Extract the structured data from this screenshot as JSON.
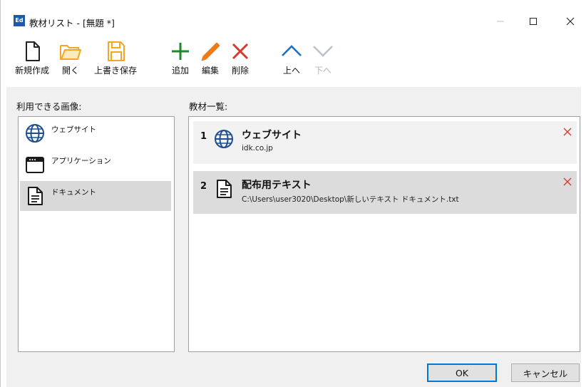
{
  "window": {
    "app_icon_text": "Ed",
    "title": "教材リスト - [無題 *]"
  },
  "toolbar": {
    "new_label": "新規作成",
    "open_label": "開く",
    "save_label": "上書き保存",
    "add_label": "追加",
    "edit_label": "編集",
    "delete_label": "削除",
    "up_label": "上へ",
    "down_label": "下へ"
  },
  "available": {
    "label": "利用できる画像:",
    "items": [
      {
        "name": "ウェブサイト",
        "icon": "globe-icon"
      },
      {
        "name": "アプリケーション",
        "icon": "app-window-icon"
      },
      {
        "name": "ドキュメント",
        "icon": "document-icon"
      }
    ],
    "selected_index": 2
  },
  "materials": {
    "label": "教材一覧:",
    "items": [
      {
        "number": "1",
        "name": "ウェブサイト",
        "detail": "idk.co.jp",
        "icon": "globe-icon"
      },
      {
        "number": "2",
        "name": "配布用テキスト",
        "detail": "C:\\Users\\user3020\\Desktop\\新しいテキスト ドキュメント.txt",
        "icon": "document-icon"
      }
    ],
    "selected_index": 1
  },
  "footer": {
    "ok_label": "OK",
    "cancel_label": "キャンセル"
  },
  "colors": {
    "add": "#1e8a2e",
    "edit": "#f07a1a",
    "delete": "#d33a2c",
    "folder": "#f5a623",
    "arrow_active": "#1f6fc2",
    "arrow_disabled": "#b9c4cf",
    "accent": "#0078d7"
  }
}
